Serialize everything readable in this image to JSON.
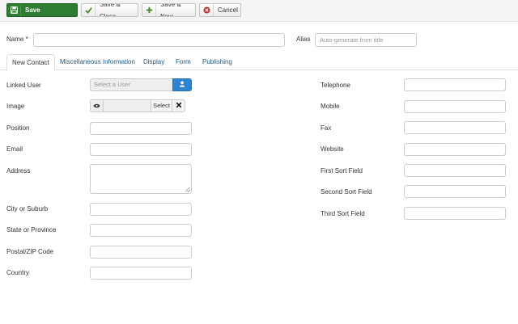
{
  "toolbar": {
    "save_label": "Save",
    "save_close_label": "Save & Close",
    "save_new_label": "Save & New",
    "cancel_label": "Cancel",
    "icons": {
      "save": "save-icon",
      "save_close": "check-icon",
      "save_new": "plus-icon",
      "cancel": "cancel-icon"
    },
    "colors": {
      "save_bg": "#2f7d32",
      "check": "#4a8a35",
      "plus": "#4a8a35",
      "cancel": "#c0392b"
    }
  },
  "header": {
    "name_label": "Name *",
    "name_value": "",
    "alias_label": "Alias",
    "alias_placeholder": "Auto-generate from title"
  },
  "tabs": [
    {
      "label": "New Contact",
      "active": true
    },
    {
      "label": "Miscellaneous Information",
      "active": false
    },
    {
      "label": "Display",
      "active": false
    },
    {
      "label": "Form",
      "active": false
    },
    {
      "label": "Publishing",
      "active": false
    }
  ],
  "left_fields": {
    "linked_user": {
      "label": "Linked User",
      "placeholder": "Select a User",
      "button_icon": "user-icon"
    },
    "image": {
      "label": "Image",
      "preview_icon": "eye-icon",
      "select_label": "Select",
      "clear_icon": "close-icon"
    },
    "position": {
      "label": "Position",
      "value": ""
    },
    "email": {
      "label": "Email",
      "value": ""
    },
    "address": {
      "label": "Address",
      "value": ""
    },
    "city": {
      "label": "City or Suburb",
      "value": ""
    },
    "state": {
      "label": "State or Province",
      "value": ""
    },
    "postcode": {
      "label": "Postal/ZIP Code",
      "value": ""
    },
    "country": {
      "label": "Country",
      "value": ""
    }
  },
  "right_fields": {
    "telephone": {
      "label": "Telephone",
      "value": ""
    },
    "mobile": {
      "label": "Mobile",
      "value": ""
    },
    "fax": {
      "label": "Fax",
      "value": ""
    },
    "website": {
      "label": "Website",
      "value": ""
    },
    "first_sort": {
      "label": "First Sort Field",
      "value": ""
    },
    "second_sort": {
      "label": "Second Sort Field",
      "value": ""
    },
    "third_sort": {
      "label": "Third Sort Field",
      "value": ""
    }
  },
  "colors": {
    "link": "#1f5a8a",
    "user_button": "#2f84d0"
  }
}
